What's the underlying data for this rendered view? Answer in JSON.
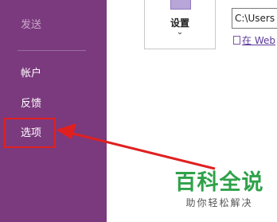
{
  "sidebar": {
    "items": [
      {
        "label": "发送"
      },
      {
        "label": "帐户"
      },
      {
        "label": "反馈"
      },
      {
        "label": "选项"
      }
    ]
  },
  "ribbon": {
    "settings_label": "设置",
    "chevron": "⌄"
  },
  "path_field": {
    "value": "C:\\Users"
  },
  "link": {
    "label": "在 Web"
  },
  "watermark": {
    "title": "百科全说",
    "subtitle": "助你轻松解决"
  },
  "colors": {
    "sidebar": "#7b3a7e",
    "highlight": "#e02020",
    "watermark": "#2fa24a"
  }
}
